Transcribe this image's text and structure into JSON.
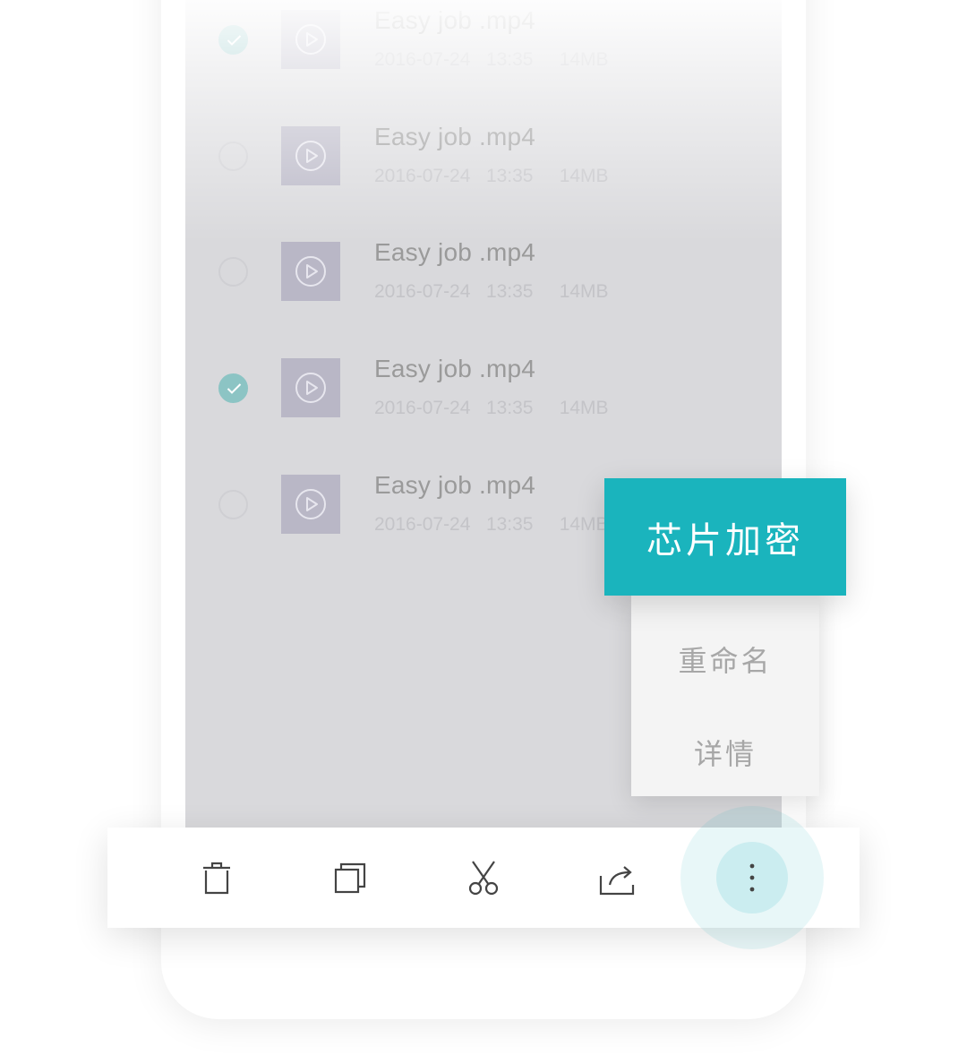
{
  "file_list": {
    "items": [
      {
        "name": "Easy job .mp4",
        "date": "2016-07-24",
        "time": "13:35",
        "size": "14MB",
        "selected": true
      },
      {
        "name": "Easy job .mp4",
        "date": "2016-07-24",
        "time": "13:35",
        "size": "14MB",
        "selected": false
      },
      {
        "name": "Easy job .mp4",
        "date": "2016-07-24",
        "time": "13:35",
        "size": "14MB",
        "selected": false
      },
      {
        "name": "Easy job .mp4",
        "date": "2016-07-24",
        "time": "13:35",
        "size": "14MB",
        "selected": true
      },
      {
        "name": "Easy job .mp4",
        "date": "2016-07-24",
        "time": "13:35",
        "size": "14MB",
        "selected": false
      }
    ]
  },
  "context_menu": {
    "primary": "芯片加密",
    "items": [
      "重命名",
      "详情"
    ]
  },
  "toolbar": {
    "icons": [
      "delete-icon",
      "copy-icon",
      "cut-icon",
      "share-icon",
      "more-vertical-icon"
    ]
  },
  "colors": {
    "accent": "#1ab4bd",
    "checked": "#8cc4c4",
    "thumbnail": "#b9b7c6",
    "overlay": "#d9d9dc"
  }
}
